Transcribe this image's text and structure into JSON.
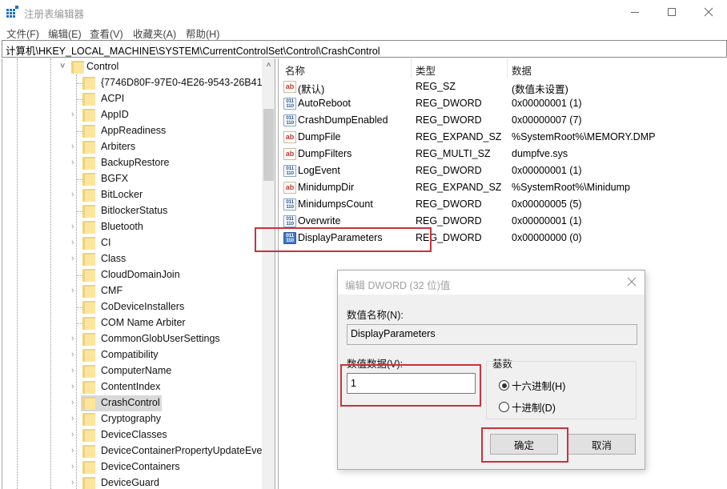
{
  "window": {
    "title": "注册表编辑器",
    "controls": {
      "minimize": "—",
      "maximize": "☐",
      "close": "✕"
    }
  },
  "menu": [
    "文件(F)",
    "编辑(E)",
    "查看(V)",
    "收藏夹(A)",
    "帮助(H)"
  ],
  "address": "计算机\\HKEY_LOCAL_MACHINE\\SYSTEM\\CurrentControlSet\\Control\\CrashControl",
  "tree": {
    "parent": "Control",
    "items": [
      {
        "label": "{7746D80F-97E0-4E26-9543-26B41",
        "expandable": false
      },
      {
        "label": "ACPI",
        "expandable": false
      },
      {
        "label": "AppID",
        "expandable": true
      },
      {
        "label": "AppReadiness",
        "expandable": false
      },
      {
        "label": "Arbiters",
        "expandable": true
      },
      {
        "label": "BackupRestore",
        "expandable": true
      },
      {
        "label": "BGFX",
        "expandable": false
      },
      {
        "label": "BitLocker",
        "expandable": true
      },
      {
        "label": "BitlockerStatus",
        "expandable": false
      },
      {
        "label": "Bluetooth",
        "expandable": true
      },
      {
        "label": "CI",
        "expandable": true
      },
      {
        "label": "Class",
        "expandable": true
      },
      {
        "label": "CloudDomainJoin",
        "expandable": false
      },
      {
        "label": "CMF",
        "expandable": true
      },
      {
        "label": "CoDeviceInstallers",
        "expandable": false
      },
      {
        "label": "COM Name Arbiter",
        "expandable": false
      },
      {
        "label": "CommonGlobUserSettings",
        "expandable": true
      },
      {
        "label": "Compatibility",
        "expandable": true
      },
      {
        "label": "ComputerName",
        "expandable": true
      },
      {
        "label": "ContentIndex",
        "expandable": true
      },
      {
        "label": "CrashControl",
        "expandable": true,
        "selected": true
      },
      {
        "label": "Cryptography",
        "expandable": true
      },
      {
        "label": "DeviceClasses",
        "expandable": true
      },
      {
        "label": "DeviceContainerPropertyUpdateEve",
        "expandable": true
      },
      {
        "label": "DeviceContainers",
        "expandable": true
      },
      {
        "label": "DeviceGuard",
        "expandable": true
      }
    ]
  },
  "list": {
    "columns": [
      "名称",
      "类型",
      "数据"
    ],
    "rows": [
      {
        "icon": "string",
        "name": "(默认)",
        "type": "REG_SZ",
        "data": "(数值未设置)"
      },
      {
        "icon": "binary",
        "name": "AutoReboot",
        "type": "REG_DWORD",
        "data": "0x00000001 (1)"
      },
      {
        "icon": "binary",
        "name": "CrashDumpEnabled",
        "type": "REG_DWORD",
        "data": "0x00000007 (7)"
      },
      {
        "icon": "string",
        "name": "DumpFile",
        "type": "REG_EXPAND_SZ",
        "data": "%SystemRoot%\\MEMORY.DMP"
      },
      {
        "icon": "string",
        "name": "DumpFilters",
        "type": "REG_MULTI_SZ",
        "data": "dumpfve.sys"
      },
      {
        "icon": "binary",
        "name": "LogEvent",
        "type": "REG_DWORD",
        "data": "0x00000001 (1)"
      },
      {
        "icon": "string",
        "name": "MinidumpDir",
        "type": "REG_EXPAND_SZ",
        "data": "%SystemRoot%\\Minidump"
      },
      {
        "icon": "binary",
        "name": "MinidumpsCount",
        "type": "REG_DWORD",
        "data": "0x00000005 (5)"
      },
      {
        "icon": "binary",
        "name": "Overwrite",
        "type": "REG_DWORD",
        "data": "0x00000001 (1)"
      },
      {
        "icon": "binary",
        "name": "DisplayParameters",
        "type": "REG_DWORD",
        "data": "0x00000000 (0)",
        "active": true
      }
    ]
  },
  "dialog": {
    "title": "编辑 DWORD (32 位)值",
    "close": "✕",
    "name_label": "数值名称(N):",
    "name_value": "DisplayParameters",
    "data_label": "数值数据(V):",
    "data_value": "1",
    "base_label": "基数",
    "base_options": [
      {
        "label": "十六进制(H)",
        "checked": true
      },
      {
        "label": "十进制(D)",
        "checked": false
      }
    ],
    "ok_label": "确定",
    "cancel_label": "取消"
  },
  "icons": {
    "string_value": "ab",
    "binary_value": "011 110",
    "scroll_up": "˄",
    "collapse": "˅",
    "expand": "›"
  },
  "colors": {
    "highlight_box": "#c9323a",
    "folder": "#fde59b",
    "selected_tree_bg": "#d9d9d9"
  }
}
